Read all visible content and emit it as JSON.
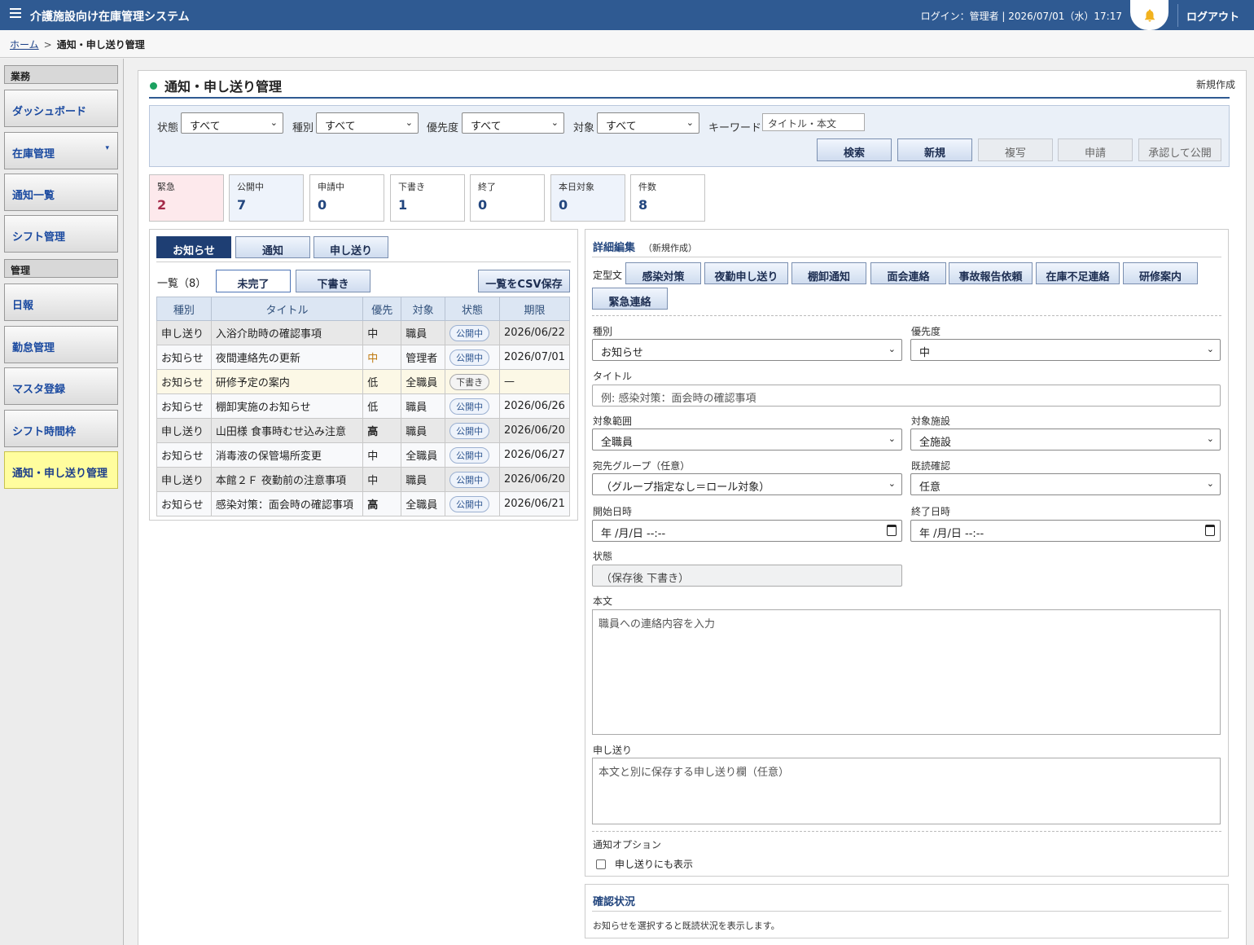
{
  "header": {
    "app_title": "介護施設向け在庫管理システム",
    "login_info": "ログイン：管理者 | 2026/07/01（水）17:17",
    "logout": "ログアウト"
  },
  "breadcrumb": {
    "home": "ホーム",
    "sep": ">",
    "current": "通知・申し送り管理"
  },
  "sidebar": {
    "group_work": "業務",
    "group_admin": "管理",
    "items": [
      {
        "label": "ダッシュボード"
      },
      {
        "label": "在庫管理"
      },
      {
        "label": "通知一覧"
      },
      {
        "label": "シフト管理"
      },
      {
        "label": "日報"
      },
      {
        "label": "勤怠管理"
      },
      {
        "label": "マスタ登録"
      },
      {
        "label": "シフト時間枠"
      },
      {
        "label": "通知・申し送り管理"
      }
    ]
  },
  "page": {
    "title": "通知・申し送り管理",
    "new_link": "新規作成"
  },
  "filters": {
    "status_label": "状態",
    "status_value": "すべて",
    "type_label": "種別",
    "type_value": "すべて",
    "priority_label": "優先度",
    "priority_value": "すべて",
    "target_label": "対象",
    "target_value": "すべて",
    "keyword_label": "キーワード",
    "keyword_placeholder": "タイトル・本文",
    "buttons": {
      "search": "検索",
      "new": "新規",
      "copy": "複写",
      "apply": "申請",
      "approve": "承認して公開"
    }
  },
  "summary": [
    {
      "label": "緊急",
      "value": "2"
    },
    {
      "label": "公開中",
      "value": "7"
    },
    {
      "label": "申請中",
      "value": "0"
    },
    {
      "label": "下書き",
      "value": "1"
    },
    {
      "label": "終了",
      "value": "0"
    },
    {
      "label": "本日対象",
      "value": "0"
    },
    {
      "label": "件数",
      "value": "8"
    }
  ],
  "list": {
    "tabs": [
      "お知らせ",
      "通知",
      "申し送り"
    ],
    "count_label": "一覧（8）",
    "filter_incomplete": "未完了",
    "filter_draft": "下書き",
    "csv_button": "一覧をCSV保存",
    "columns": [
      "種別",
      "タイトル",
      "優先",
      "対象",
      "状態",
      "期限"
    ],
    "rows": [
      {
        "type": "申し送り",
        "title": "入浴介助時の確認事項",
        "priority": "中",
        "target": "職員",
        "status": "公開中",
        "due": "2026/06/22"
      },
      {
        "type": "お知らせ",
        "title": "夜間連絡先の更新",
        "priority": "中",
        "target": "管理者",
        "status": "公開中",
        "due": "2026/07/01"
      },
      {
        "type": "お知らせ",
        "title": "研修予定の案内",
        "priority": "低",
        "target": "全職員",
        "status": "下書き",
        "due": "—"
      },
      {
        "type": "お知らせ",
        "title": "棚卸実施のお知らせ",
        "priority": "低",
        "target": "職員",
        "status": "公開中",
        "due": "2026/06/26"
      },
      {
        "type": "申し送り",
        "title": "山田様 食事時むせ込み注意",
        "priority": "高",
        "target": "職員",
        "status": "公開中",
        "due": "2026/06/20"
      },
      {
        "type": "お知らせ",
        "title": "消毒液の保管場所変更",
        "priority": "中",
        "target": "全職員",
        "status": "公開中",
        "due": "2026/06/27"
      },
      {
        "type": "申し送り",
        "title": "本館２Ｆ 夜勤前の注意事項",
        "priority": "中",
        "target": "職員",
        "status": "公開中",
        "due": "2026/06/20"
      },
      {
        "type": "お知らせ",
        "title": "感染対策：面会時の確認事項",
        "priority": "高",
        "target": "全職員",
        "status": "公開中",
        "due": "2026/06/21"
      }
    ]
  },
  "edit": {
    "heading": "詳細編集",
    "sub": "（新規作成）",
    "template_label": "定型文",
    "templates": [
      "感染対策",
      "夜勤申し送り",
      "棚卸通知",
      "面会連絡",
      "事故報告依頼",
      "在庫不足連絡",
      "研修案内",
      "緊急連絡"
    ],
    "type_label": "種別",
    "type_value": "お知らせ",
    "priority_label": "優先度",
    "priority_value": "中",
    "title_label": "タイトル",
    "title_placeholder": "例: 感染対策：面会時の確認事項",
    "scope_label": "対象範囲",
    "scope_value": "全職員",
    "facility_label": "対象施設",
    "facility_value": "全施設",
    "group_label": "宛先グループ（任意）",
    "group_value": "（グループ指定なし＝ロール対象）",
    "read_label": "既読確認",
    "read_value": "任意",
    "start_label": "開始日時",
    "start_value": "年 /月/日 --:--",
    "end_label": "終了日時",
    "end_value": "年 /月/日 --:--",
    "state_label": "状態",
    "state_value": "（保存後 下書き）",
    "body_label": "本文",
    "body_placeholder": "職員への連絡内容を入力",
    "handover_label": "申し送り",
    "handover_placeholder": "本文と別に保存する申し送り欄（任意）",
    "options_label": "通知オプション",
    "option_handover": "申し送りにも表示"
  },
  "confirm": {
    "heading": "確認状況",
    "text": "お知らせを選択すると既読状況を表示します。"
  },
  "colors": {
    "brand": "#2f5a92",
    "accent_green": "#1ba160",
    "urgent": "#a32a48",
    "active_nav": "#fffd9e"
  }
}
